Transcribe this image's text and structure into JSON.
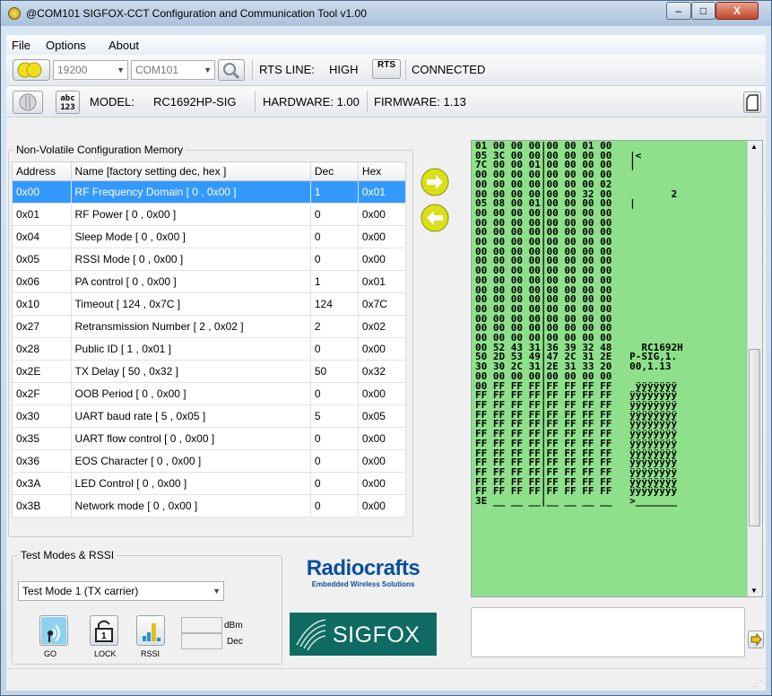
{
  "window": {
    "title": "@COM101 SIGFOX-CCT Configuration and Communication Tool v1.00",
    "min_glyph": "–",
    "max_glyph": "□",
    "close_glyph": "X"
  },
  "menu": {
    "file": "File",
    "options": "Options",
    "about": "About"
  },
  "toolbar1": {
    "baud": "19200",
    "port": "COM101",
    "rts_line_label": "RTS LINE:",
    "rts_line_value": "HIGH",
    "rts_button": "RTS",
    "status": "CONNECTED"
  },
  "toolbar2": {
    "abc_button_top": "abc",
    "abc_button_bottom": "123",
    "model_label": "MODEL:",
    "model_value": "RC1692HP-SIG",
    "hardware": "HARDWARE: 1.00",
    "firmware": "FIRMWARE: 1.13"
  },
  "nvm": {
    "title": "Non-Volatile Configuration Memory",
    "columns": {
      "address": "Address",
      "name": "Name  [factory setting dec, hex ]",
      "dec": "Dec",
      "hex": "Hex"
    },
    "rows": [
      {
        "address": "0x00",
        "name": "RF Frequency Domain [ 0 , 0x00 ]",
        "dec": "1",
        "hex": "0x01"
      },
      {
        "address": "0x01",
        "name": "RF Power [ 0 , 0x00 ]",
        "dec": "0",
        "hex": "0x00"
      },
      {
        "address": "0x04",
        "name": "Sleep Mode [ 0 , 0x00 ]",
        "dec": "0",
        "hex": "0x00"
      },
      {
        "address": "0x05",
        "name": "RSSI Mode [ 0 , 0x00 ]",
        "dec": "0",
        "hex": "0x00"
      },
      {
        "address": "0x06",
        "name": "PA control [ 0 , 0x00 ]",
        "dec": "1",
        "hex": "0x01"
      },
      {
        "address": "0x10",
        "name": "Timeout [ 124 , 0x7C ]",
        "dec": "124",
        "hex": "0x7C"
      },
      {
        "address": "0x27",
        "name": "Retransmission Number [ 2 , 0x02 ]",
        "dec": "2",
        "hex": "0x02"
      },
      {
        "address": "0x28",
        "name": "Public ID [ 1 , 0x01 ]",
        "dec": "0",
        "hex": "0x00"
      },
      {
        "address": "0x2E",
        "name": "TX Delay [ 50 , 0x32 ]",
        "dec": "50",
        "hex": "0x32"
      },
      {
        "address": "0x2F",
        "name": "OOB Period [ 0 , 0x00 ]",
        "dec": "0",
        "hex": "0x00"
      },
      {
        "address": "0x30",
        "name": "UART baud rate [ 5 , 0x05 ]",
        "dec": "5",
        "hex": "0x05"
      },
      {
        "address": "0x35",
        "name": "UART flow control [ 0 , 0x00 ]",
        "dec": "0",
        "hex": "0x00"
      },
      {
        "address": "0x36",
        "name": "EOS Character [ 0 , 0x00 ]",
        "dec": "0",
        "hex": "0x00"
      },
      {
        "address": "0x3A",
        "name": "LED Control [ 0 , 0x00 ]",
        "dec": "0",
        "hex": "0x00"
      },
      {
        "address": "0x3B",
        "name": "Network mode [ 0 , 0x00 ]",
        "dec": "0",
        "hex": "0x00"
      }
    ]
  },
  "test": {
    "title": "Test Modes & RSSI",
    "mode": "Test Mode 1 (TX carrier)",
    "dbm_label": "dBm",
    "dec_label": "Dec",
    "go": "GO",
    "lock": "LOCK",
    "lock_glyph": "1",
    "rssi": "RSSI"
  },
  "branding": {
    "radiocrafts": "Radiocrafts",
    "tagline": "Embedded Wireless Solutions",
    "sigfox": "SIGFOX"
  },
  "hexdump": [
    "01 00 00 00|00 00 01 00",
    "05 3C 00 00|00 00 00 00   |<",
    "7C 00 00 01|00 00 00 00   |",
    "00 00 00 00|00 00 00 00",
    "00 00 00 00|00 00 00 02",
    "00 00 00 00|00 00 32 00          2",
    "05 08 00 01|00 00 00 00   |",
    "00 00 00 00|00 00 00 00",
    "00 00 00 00|00 00 00 00",
    "00 00 00 00|00 00 00 00",
    "00 00 00 00|00 00 00 00",
    "00 00 00 00|00 00 00 00",
    "00 00 00 00|00 00 00 00",
    "00 00 00 00|00 00 00 00",
    "00 00 00 00|00 00 00 00",
    "00 00 00 00|00 00 00 00",
    "00 00 00 00|00 00 00 00",
    "00 00 00 00|00 00 00 00",
    "00 00 00 00|00 00 00 00",
    "00 00 00 00|00 00 00 00",
    "00 00 00 00|00 00 00 00",
    "00 52 43 31|36 39 32 48     RC1692H",
    "50 2D 53 49|47 2C 31 2E   P-SIG,1.",
    "30 30 2C 31|2E 31 33 20   00,1.13",
    "00 00 00 00|00 00 00 00",
    "00 FF FF FF|FF FF FF FF    ÿÿÿÿÿÿÿ",
    "FF FF FF FF|FF FF FF FF   ÿÿÿÿÿÿÿÿ",
    "FF FF FF FF|FF FF FF FF   ÿÿÿÿÿÿÿÿ",
    "FF FF FF FF|FF FF FF FF   ÿÿÿÿÿÿÿÿ",
    "FF FF FF FF|FF FF FF FF   ÿÿÿÿÿÿÿÿ",
    "FF FF FF FF|FF FF FF FF   ÿÿÿÿÿÿÿÿ",
    "FF FF FF FF|FF FF FF FF   ÿÿÿÿÿÿÿÿ",
    "FF FF FF FF|FF FF FF FF   ÿÿÿÿÿÿÿÿ",
    "FF FF FF FF|FF FF FF FF   ÿÿÿÿÿÿÿÿ",
    "FF FF FF FF|FF FF FF FF   ÿÿÿÿÿÿÿÿ",
    "FF FF FF FF|FF FF FF FF   ÿÿÿÿÿÿÿÿ",
    "FF FF FF FF|FF FF FF FF   ÿÿÿÿÿÿÿÿ",
    "3E __ __ __|__ __ __ __   >_______"
  ],
  "colors": {
    "hex_bg": "#8ee08a",
    "selection": "#3399ff",
    "arrow_yellow": "#d9e018",
    "led_yellow": "#f2df1c"
  }
}
